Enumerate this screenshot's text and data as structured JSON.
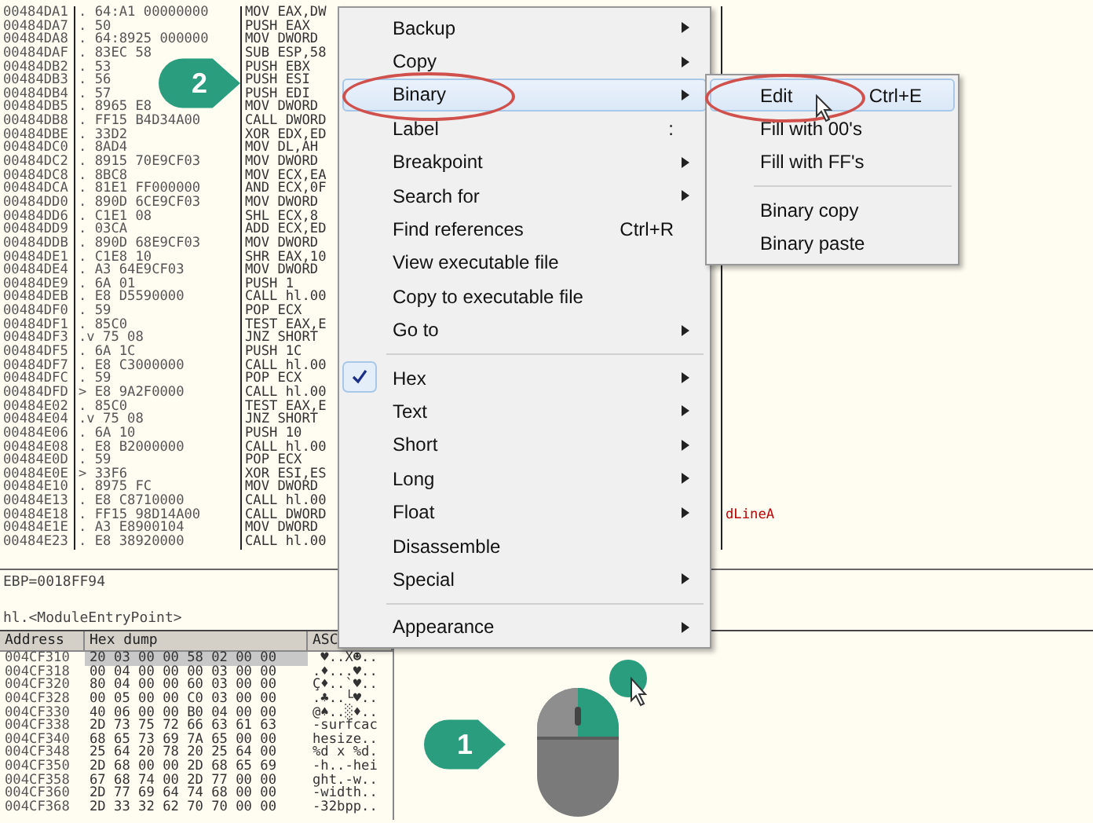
{
  "disassembly": {
    "rows": [
      {
        "address": "00484DA1",
        "marker": ".",
        "hex": "64:A1 00000000",
        "code": "MOV EAX,DW"
      },
      {
        "address": "00484DA7",
        "marker": ".",
        "hex": "50",
        "code": "PUSH EAX"
      },
      {
        "address": "00484DA8",
        "marker": ".",
        "hex": "64:8925 000000",
        "code": "MOV DWORD"
      },
      {
        "address": "00484DAF",
        "marker": ".",
        "hex": "83EC 58",
        "code": "SUB ESP,58"
      },
      {
        "address": "00484DB2",
        "marker": ".",
        "hex": "53",
        "code": "PUSH EBX"
      },
      {
        "address": "00484DB3",
        "marker": ".",
        "hex": "56",
        "code": "PUSH ESI"
      },
      {
        "address": "00484DB4",
        "marker": ".",
        "hex": "57",
        "code": "PUSH EDI"
      },
      {
        "address": "00484DB5",
        "marker": ".",
        "hex": "8965 E8",
        "code": "MOV DWORD"
      },
      {
        "address": "00484DB8",
        "marker": ".",
        "hex": "FF15 B4D34A00",
        "code": "CALL DWORD"
      },
      {
        "address": "00484DBE",
        "marker": ".",
        "hex": "33D2",
        "code": "XOR EDX,ED"
      },
      {
        "address": "00484DC0",
        "marker": ".",
        "hex": "8AD4",
        "code": "MOV DL,AH"
      },
      {
        "address": "00484DC2",
        "marker": ".",
        "hex": "8915 70E9CF03",
        "code": "MOV DWORD"
      },
      {
        "address": "00484DC8",
        "marker": ".",
        "hex": "8BC8",
        "code": "MOV ECX,EA"
      },
      {
        "address": "00484DCA",
        "marker": ".",
        "hex": "81E1 FF000000",
        "code": "AND ECX,0F"
      },
      {
        "address": "00484DD0",
        "marker": ".",
        "hex": "890D 6CE9CF03",
        "code": "MOV DWORD"
      },
      {
        "address": "00484DD6",
        "marker": ".",
        "hex": "C1E1 08",
        "code": "SHL ECX,8"
      },
      {
        "address": "00484DD9",
        "marker": ".",
        "hex": "03CA",
        "code": "ADD ECX,ED"
      },
      {
        "address": "00484DDB",
        "marker": ".",
        "hex": "890D 68E9CF03",
        "code": "MOV DWORD"
      },
      {
        "address": "00484DE1",
        "marker": ".",
        "hex": "C1E8 10",
        "code": "SHR EAX,10"
      },
      {
        "address": "00484DE4",
        "marker": ".",
        "hex": "A3 64E9CF03",
        "code": "MOV DWORD"
      },
      {
        "address": "00484DE9",
        "marker": ".",
        "hex": "6A 01",
        "code": "PUSH 1"
      },
      {
        "address": "00484DEB",
        "marker": ".",
        "hex": "E8 D5590000",
        "code": "CALL hl.00"
      },
      {
        "address": "00484DF0",
        "marker": ".",
        "hex": "59",
        "code": "POP ECX"
      },
      {
        "address": "00484DF1",
        "marker": ".",
        "hex": "85C0",
        "code": "TEST EAX,E"
      },
      {
        "address": "00484DF3",
        "marker": ".v",
        "hex": "75 08",
        "code": "JNZ SHORT"
      },
      {
        "address": "00484DF5",
        "marker": ".",
        "hex": "6A 1C",
        "code": "PUSH 1C"
      },
      {
        "address": "00484DF7",
        "marker": ".",
        "hex": "E8 C3000000",
        "code": "CALL hl.00"
      },
      {
        "address": "00484DFC",
        "marker": ".",
        "hex": "59",
        "code": "POP ECX"
      },
      {
        "address": "00484DFD",
        "marker": ">",
        "hex": "E8 9A2F0000",
        "code": "CALL hl.00"
      },
      {
        "address": "00484E02",
        "marker": ".",
        "hex": "85C0",
        "code": "TEST EAX,E"
      },
      {
        "address": "00484E04",
        "marker": ".v",
        "hex": "75 08",
        "code": "JNZ SHORT"
      },
      {
        "address": "00484E06",
        "marker": ".",
        "hex": "6A 10",
        "code": "PUSH 10"
      },
      {
        "address": "00484E08",
        "marker": ".",
        "hex": "E8 B2000000",
        "code": "CALL hl.00"
      },
      {
        "address": "00484E0D",
        "marker": ".",
        "hex": "59",
        "code": "POP ECX"
      },
      {
        "address": "00484E0E",
        "marker": ">",
        "hex": "33F6",
        "code": "XOR ESI,ES"
      },
      {
        "address": "00484E10",
        "marker": ".",
        "hex": "8975 FC",
        "code": "MOV DWORD"
      },
      {
        "address": "00484E13",
        "marker": ".",
        "hex": "E8 C8710000",
        "code": "CALL hl.00"
      },
      {
        "address": "00484E18",
        "marker": ".",
        "hex": "FF15 98D14A00",
        "code": "CALL DWORD",
        "comment": {
          "text": "dLineA",
          "kind": "api"
        }
      },
      {
        "address": "00484E1E",
        "marker": ".",
        "hex": "A3 E8900104",
        "code": "MOV DWORD"
      },
      {
        "address": "00484E23",
        "marker": ".",
        "hex": "E8 38920000",
        "code": "CALL hl.00"
      }
    ]
  },
  "registers": "EBP=0018FF94",
  "location": "hl.<ModuleEntryPoint>",
  "dump": {
    "columns": [
      "Address",
      "Hex dump",
      "ASC"
    ],
    "rows": [
      {
        "address": "004CF310",
        "hex": "20 03 00 00 58 02 00 00",
        "ascii": " ♥..X☻..",
        "selected": true
      },
      {
        "address": "004CF318",
        "hex": "00 04 00 00 00 03 00 00",
        "ascii": ".♦...♥..",
        "selected": false
      },
      {
        "address": "004CF320",
        "hex": "80 04 00 00 60 03 00 00",
        "ascii": "Ç♦..`♥..",
        "selected": false
      },
      {
        "address": "004CF328",
        "hex": "00 05 00 00 C0 03 00 00",
        "ascii": ".♣..└♥..",
        "selected": false
      },
      {
        "address": "004CF330",
        "hex": "40 06 00 00 B0 04 00 00",
        "ascii": "@♠..░♦..",
        "selected": false
      },
      {
        "address": "004CF338",
        "hex": "2D 73 75 72 66 63 61 63",
        "ascii": "-surfcac",
        "selected": false
      },
      {
        "address": "004CF340",
        "hex": "68 65 73 69 7A 65 00 00",
        "ascii": "hesize..",
        "selected": false
      },
      {
        "address": "004CF348",
        "hex": "25 64 20 78 20 25 64 00",
        "ascii": "%d x %d.",
        "selected": false
      },
      {
        "address": "004CF350",
        "hex": "2D 68 00 00 2D 68 65 69",
        "ascii": "-h..-hei",
        "selected": false
      },
      {
        "address": "004CF358",
        "hex": "67 68 74 00 2D 77 00 00",
        "ascii": "ght.-w..",
        "selected": false
      },
      {
        "address": "004CF360",
        "hex": "2D 77 69 64 74 68 00 00",
        "ascii": "-width..",
        "selected": false
      },
      {
        "address": "004CF368",
        "hex": "2D 33 32 62 70 70 00 00",
        "ascii": "-32bpp..",
        "selected": false
      }
    ]
  },
  "context_menu": {
    "items": [
      {
        "kind": "submenu",
        "label": "Backup",
        "checked": false,
        "selected": false
      },
      {
        "kind": "submenu",
        "label": "Copy",
        "checked": false,
        "selected": false
      },
      {
        "kind": "submenu",
        "label": "Binary",
        "checked": false,
        "selected": true
      },
      {
        "kind": "command",
        "label": "Label",
        "shortcut": ":",
        "checked": false,
        "selected": false
      },
      {
        "kind": "submenu",
        "label": "Breakpoint",
        "checked": false,
        "selected": false
      },
      {
        "kind": "submenu",
        "label": "Search for",
        "checked": false,
        "selected": false
      },
      {
        "kind": "command",
        "label": "Find references",
        "shortcut": "Ctrl+R",
        "checked": false,
        "selected": false
      },
      {
        "kind": "command",
        "label": "View executable file",
        "checked": false,
        "selected": false
      },
      {
        "kind": "command",
        "label": "Copy to executable file",
        "checked": false,
        "selected": false
      },
      {
        "kind": "submenu",
        "label": "Go to",
        "checked": false,
        "selected": false
      },
      {
        "kind": "separator"
      },
      {
        "kind": "submenu",
        "label": "Hex",
        "checked": true,
        "selected": false
      },
      {
        "kind": "submenu",
        "label": "Text",
        "checked": false,
        "selected": false
      },
      {
        "kind": "submenu",
        "label": "Short",
        "checked": false,
        "selected": false
      },
      {
        "kind": "submenu",
        "label": "Long",
        "checked": false,
        "selected": false
      },
      {
        "kind": "submenu",
        "label": "Float",
        "checked": false,
        "selected": false
      },
      {
        "kind": "command",
        "label": "Disassemble",
        "checked": false,
        "selected": false
      },
      {
        "kind": "submenu",
        "label": "Special",
        "checked": false,
        "selected": false
      },
      {
        "kind": "separator"
      },
      {
        "kind": "submenu",
        "label": "Appearance",
        "checked": false,
        "selected": false
      }
    ]
  },
  "submenu": {
    "items": [
      {
        "kind": "command",
        "label": "Edit",
        "shortcut": "Ctrl+E",
        "selected": true
      },
      {
        "kind": "command",
        "label": "Fill with 00's",
        "selected": false
      },
      {
        "kind": "command",
        "label": "Fill with FF's",
        "selected": false
      },
      {
        "kind": "separator"
      },
      {
        "kind": "command",
        "label": "Binary copy",
        "selected": false
      },
      {
        "kind": "command",
        "label": "Binary paste",
        "selected": false
      }
    ]
  },
  "callouts": [
    {
      "label": "2"
    },
    {
      "label": "1"
    }
  ]
}
